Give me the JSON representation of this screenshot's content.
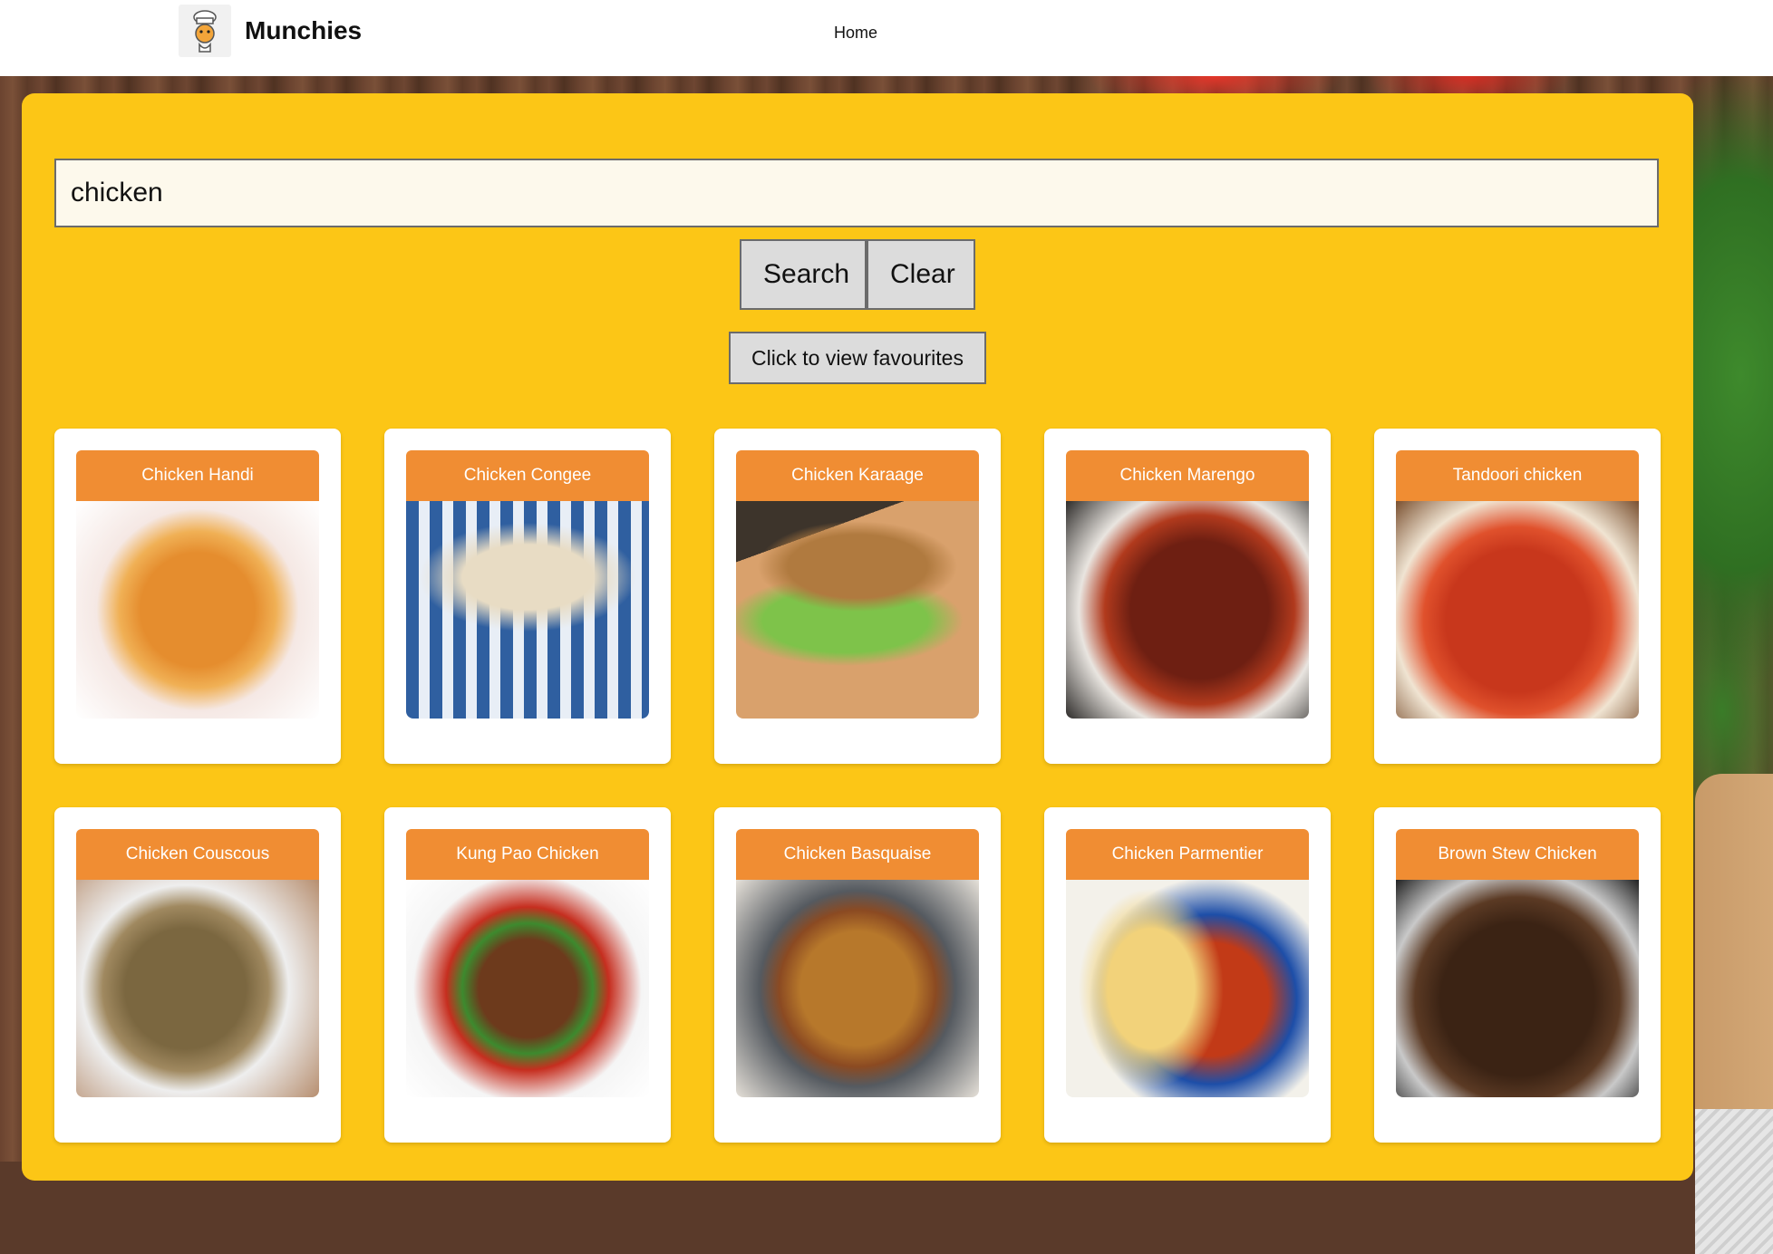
{
  "header": {
    "brand": "Munchies",
    "nav": [
      "Home"
    ]
  },
  "search": {
    "value": "chicken",
    "search_label": "Search",
    "clear_label": "Clear",
    "favourites_label": "Click to view favourites"
  },
  "recipes": [
    {
      "title": "Chicken Handi"
    },
    {
      "title": "Chicken Congee"
    },
    {
      "title": "Chicken Karaage"
    },
    {
      "title": "Chicken Marengo"
    },
    {
      "title": "Tandoori chicken"
    },
    {
      "title": "Chicken Couscous"
    },
    {
      "title": "Kung Pao Chicken"
    },
    {
      "title": "Chicken Basquaise"
    },
    {
      "title": "Chicken Parmentier"
    },
    {
      "title": "Brown Stew Chicken"
    }
  ],
  "colors": {
    "panel": "#fcc616",
    "card_title_bg": "#f08d33",
    "card_bg": "#ffffff"
  }
}
